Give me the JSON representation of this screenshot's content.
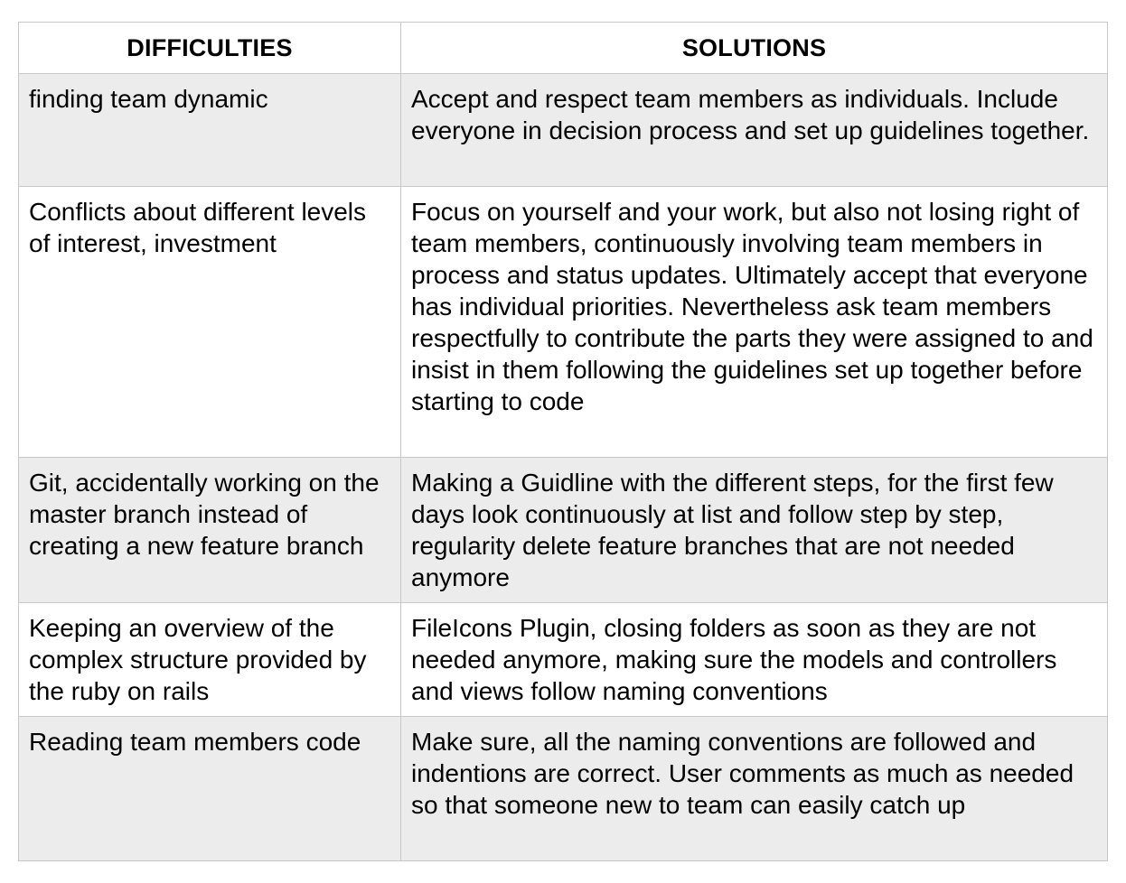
{
  "table": {
    "headers": [
      "DIFFICULTIES",
      "SOLUTIONS"
    ],
    "rows": [
      {
        "difficulty": "finding team dynamic",
        "solution": "Accept and respect team members as individuals. Include everyone in decision process and set up guidelines together."
      },
      {
        "difficulty": "Conflicts about different levels of interest, investment",
        "solution": "Focus on yourself and your work, but also not losing right of team members, continuously involving team members in process and status updates. Ultimately accept that everyone has individual priorities. Nevertheless ask team members respectfully to contribute the parts they were assigned to and insist in them following the guidelines set up together before starting to code"
      },
      {
        "difficulty": "Git, accidentally working on the master branch instead of creating a new feature branch",
        "solution": "Making a Guidline with the different steps, for the first few days look continuously at list and follow step by step, regularity delete feature branches that are not needed anymore"
      },
      {
        "difficulty": "Keeping an overview of the complex structure provided by the ruby on rails",
        "solution": "FileIcons Plugin, closing folders as soon as they are not needed anymore, making sure the models and controllers and views follow naming conventions"
      },
      {
        "difficulty": "Reading team members code",
        "solution": "Make sure, all the naming conventions are followed and indentions are correct. User comments as much as needed so that someone new to team can easily catch up"
      }
    ]
  }
}
